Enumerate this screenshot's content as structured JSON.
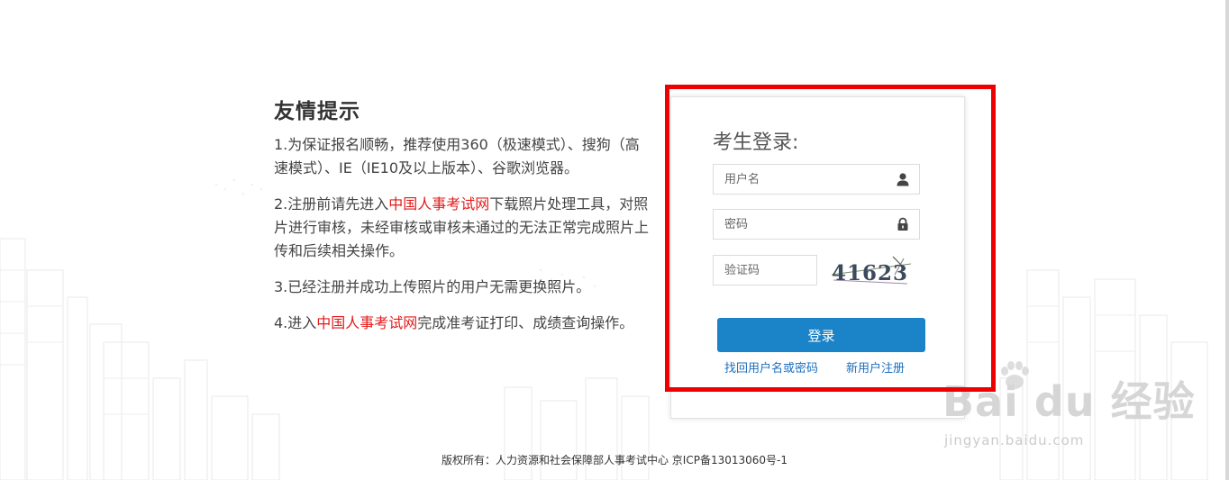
{
  "tips": {
    "heading": "友情提示",
    "item1": "1.为保证报名顺畅，推荐使用360（极速模式）、搜狗（高速模式）、IE（IE10及以上版本）、谷歌浏览器。",
    "item2_before": "2.注册前请先进入",
    "item2_link": "中国人事考试网",
    "item2_after": "下载照片处理工具，对照片进行审核，未经审核或审核未通过的无法正常完成照片上传和后续相关操作。",
    "item3": "3.已经注册并成功上传照片的用户无需更换照片。",
    "item4_before": "4.进入",
    "item4_link": "中国人事考试网",
    "item4_after": "完成准考证打印、成绩查询操作。"
  },
  "login": {
    "title": "考生登录:",
    "username_placeholder": "用户名",
    "username_icon": "user-icon",
    "password_placeholder": "密码",
    "password_icon": "lock-icon",
    "captcha_placeholder": "验证码",
    "captcha_text": "41623",
    "submit_label": "登录",
    "find_link": "找回用户名或密码",
    "register_link": "新用户注册",
    "button_color": "#1b83c8",
    "highlight_color": "#ee0000"
  },
  "footer": {
    "text": "版权所有：人力资源和社会保障部人事考试中心 京ICP备13013060号-1"
  },
  "watermark": {
    "main": "Bai du 经验",
    "sub": "jingyan.baidu.com"
  }
}
